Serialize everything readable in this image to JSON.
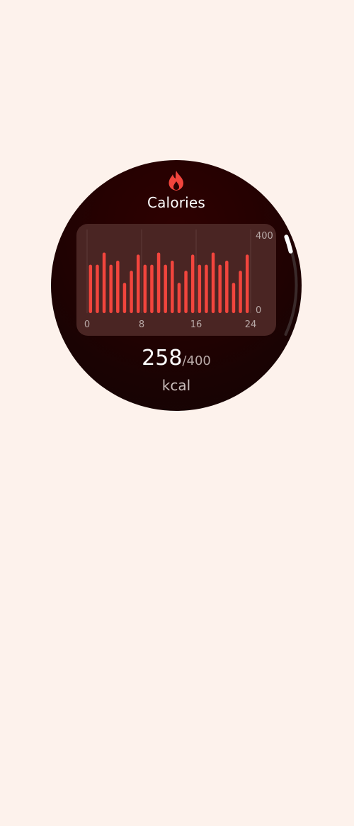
{
  "app": {
    "title": "Calories",
    "icon": "flame-icon",
    "accent_color": "#f2453d"
  },
  "summary": {
    "value": "258",
    "goal": "/400",
    "unit": "kcal"
  },
  "chart_data": {
    "type": "bar",
    "x_ticks": [
      "0",
      "8",
      "16",
      "24"
    ],
    "y_ticks": [
      "400",
      "0"
    ],
    "ylim": [
      0,
      400
    ],
    "xlim": [
      0,
      24
    ],
    "grid": "vertical",
    "bar_color": "#f2453d",
    "values": [
      240,
      240,
      300,
      240,
      260,
      150,
      210,
      290,
      240,
      240,
      300,
      240,
      260,
      150,
      210,
      290,
      240,
      240,
      300,
      240,
      260,
      150,
      210,
      290
    ]
  }
}
